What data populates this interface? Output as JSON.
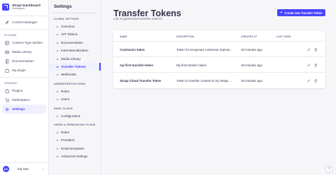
{
  "brand": {
    "name": "Strapi Dashboard",
    "subtitle": "Workspace"
  },
  "nav": {
    "content_manager": "Content Manager",
    "plugins_section": "PLUGINS",
    "plugins_items": [
      "Content-Type Builder",
      "Media Library",
      "Documentation",
      "My plugin"
    ],
    "general_section": "GENERAL",
    "general_items": [
      "Plugins",
      "Marketplace",
      "Settings"
    ]
  },
  "user": {
    "initials": "KD",
    "name": "Kai Doe"
  },
  "settings": {
    "title": "Settings",
    "global_section": "GLOBAL SETTINGS",
    "global_items": [
      "Overview",
      "API Tokens",
      "Documentation",
      "Internationalization",
      "Media Library",
      "Transfer Tokens",
      "Webhooks"
    ],
    "admin_section": "ADMINISTRATION PANEL",
    "admin_items": [
      "Roles",
      "Users"
    ],
    "email_section": "EMAIL PLUGIN",
    "email_items": [
      "Configuration"
    ],
    "users_section": "USERS & PERMISSIONS PLUGIN",
    "users_items": [
      "Roles",
      "Providers",
      "Email templates",
      "Advanced settings"
    ]
  },
  "page": {
    "title": "Transfer Tokens",
    "subtitle": "List of generated transfer tokens",
    "create_button": "Create new Transfer Token"
  },
  "table": {
    "headers": {
      "name": "NAME",
      "description": "DESCRIPTION",
      "created_at": "CREATED AT",
      "last_used": "LAST USED"
    },
    "rows": [
      {
        "name": "Contractor token",
        "description": "Token for temporary contractor improvi...",
        "created_at": "45 minutes ago",
        "last_used": ""
      },
      {
        "name": "my-first-transfer-token",
        "description": "My first transfer token",
        "created_at": "48 minutes ago",
        "last_used": ""
      },
      {
        "name": "Strapi Cloud Transfer Token",
        "description": "Token to transfer content to my Strapi ...",
        "created_at": "46 minutes ago",
        "last_used": ""
      }
    ]
  },
  "colors": {
    "primary": "#4945ff",
    "active_bg": "#f0f0ff",
    "danger": "#d02b20"
  },
  "icons": {
    "brand": "strapi-logo-icon",
    "content_manager": "feather-icon",
    "content_type_builder": "layout-icon",
    "media_library": "image-icon",
    "documentation": "book-icon",
    "my_plugin": "puzzle-icon",
    "plugins": "puzzle-icon",
    "marketplace": "shopping-cart-icon",
    "settings": "gear-icon",
    "edit": "pencil-icon",
    "delete": "trash-icon",
    "help": "question-icon",
    "collapse": "chevron-left-icon"
  }
}
